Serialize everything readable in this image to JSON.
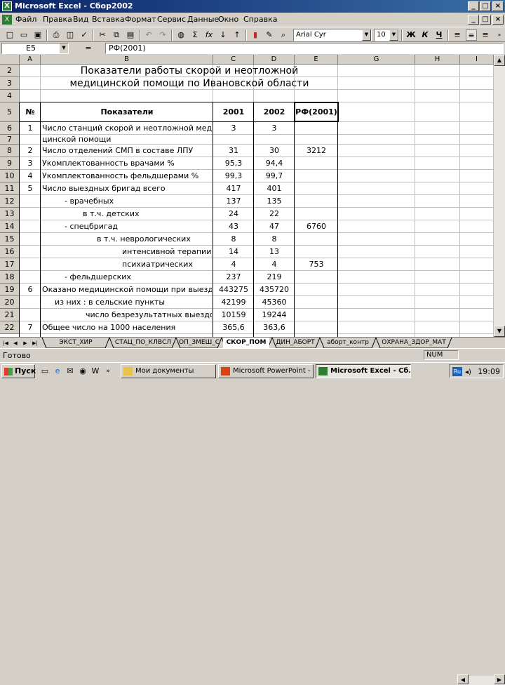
{
  "window": {
    "title": "Microsoft Excel - Сбор2002",
    "icon": "excel-icon"
  },
  "menu": [
    "Файл",
    "Правка",
    "Вид",
    "Вставка",
    "Формат",
    "Сервис",
    "Данные",
    "Окно",
    "Справка"
  ],
  "toolbar": {
    "font": "Arial Cyr",
    "size": "10",
    "bold": "Ж",
    "italic": "К",
    "underline": "Ч",
    "sum": "Σ",
    "fx": "fx"
  },
  "formula": {
    "cell_ref": "E5",
    "eq": "=",
    "content": "РФ(2001)"
  },
  "columns": [
    "A",
    "B",
    "C",
    "D",
    "E",
    "G",
    "H",
    "I"
  ],
  "rows": [
    "2",
    "3",
    "4",
    "5",
    "6",
    "7",
    "8",
    "9",
    "10",
    "11",
    "12",
    "13",
    "14",
    "15",
    "16",
    "17",
    "18",
    "19",
    "20",
    "21",
    "22"
  ],
  "sheet": {
    "title_line1": "Показатели работы скорой и неотложной",
    "title_line2": "медицинской помощи по Ивановской области",
    "headers": {
      "num": "№",
      "name": "Показатели",
      "y2001": "2001",
      "y2002": "2002",
      "rf": "РФ(2001)"
    },
    "data": [
      {
        "n": "1",
        "name": "Число станций скорой и неотложной меди-",
        "a": "3",
        "b": "3",
        "rf": ""
      },
      {
        "n": "",
        "name": "цинской помощи",
        "a": "",
        "b": "",
        "rf": ""
      },
      {
        "n": "2",
        "name": "Число отделений СМП в составе ЛПУ",
        "a": "31",
        "b": "30",
        "rf": "3212"
      },
      {
        "n": "3",
        "name": "Укомплектованность врачами %",
        "a": "95,3",
        "b": "94,4",
        "rf": ""
      },
      {
        "n": "4",
        "name": "Укомплектованность фельдшерами %",
        "a": "99,3",
        "b": "99,7",
        "rf": ""
      },
      {
        "n": "5",
        "name": "Число выездных бригад всего",
        "a": "417",
        "b": "401",
        "rf": ""
      },
      {
        "n": "",
        "name": "- врачебных",
        "a": "137",
        "b": "135",
        "rf": ""
      },
      {
        "n": "",
        "name": "в т.ч. детских",
        "a": "24",
        "b": "22",
        "rf": ""
      },
      {
        "n": "",
        "name": "- спецбригад",
        "a": "43",
        "b": "47",
        "rf": "6760"
      },
      {
        "n": "",
        "name": "в т.ч. неврологических",
        "a": "8",
        "b": "8",
        "rf": ""
      },
      {
        "n": "",
        "name": "интенсивной терапии",
        "a": "14",
        "b": "13",
        "rf": ""
      },
      {
        "n": "",
        "name": "психиатрических",
        "a": "4",
        "b": "4",
        "rf": "753"
      },
      {
        "n": "",
        "name": "- фельдшерских",
        "a": "237",
        "b": "219",
        "rf": ""
      },
      {
        "n": "6",
        "name": "Оказано медицинской помощи при выездах",
        "a": "443275",
        "b": "435720",
        "rf": ""
      },
      {
        "n": "",
        "name": "из них : в сельские пункты",
        "a": "42199",
        "b": "45360",
        "rf": ""
      },
      {
        "n": "",
        "name": "число безрезультатных выездов",
        "a": "10159",
        "b": "19244",
        "rf": ""
      },
      {
        "n": "7",
        "name": "Общее число на 1000 населения",
        "a": "365,6",
        "b": "363,6",
        "rf": ""
      }
    ]
  },
  "tabs": [
    "ЭКСТ_ХИР",
    "СТАЦ_ПО_КЛВСЛ",
    "ОП_ЗМЕШ_СТАЦ",
    "СКОР_ПОМ",
    "ДИН_АБОРТ",
    "аборт_контр",
    "ОХРАНА_ЗДОР_МАТ"
  ],
  "active_tab": "СКОР_ПОМ",
  "status": {
    "ready": "Готово",
    "num": "NUM"
  },
  "taskbar": {
    "start": "Пуск",
    "tasks": [
      "Мои документы",
      "Microsoft PowerPoint - [...",
      "Microsoft Excel - Сб..."
    ],
    "lang": "Ru",
    "clock": "19:09"
  }
}
